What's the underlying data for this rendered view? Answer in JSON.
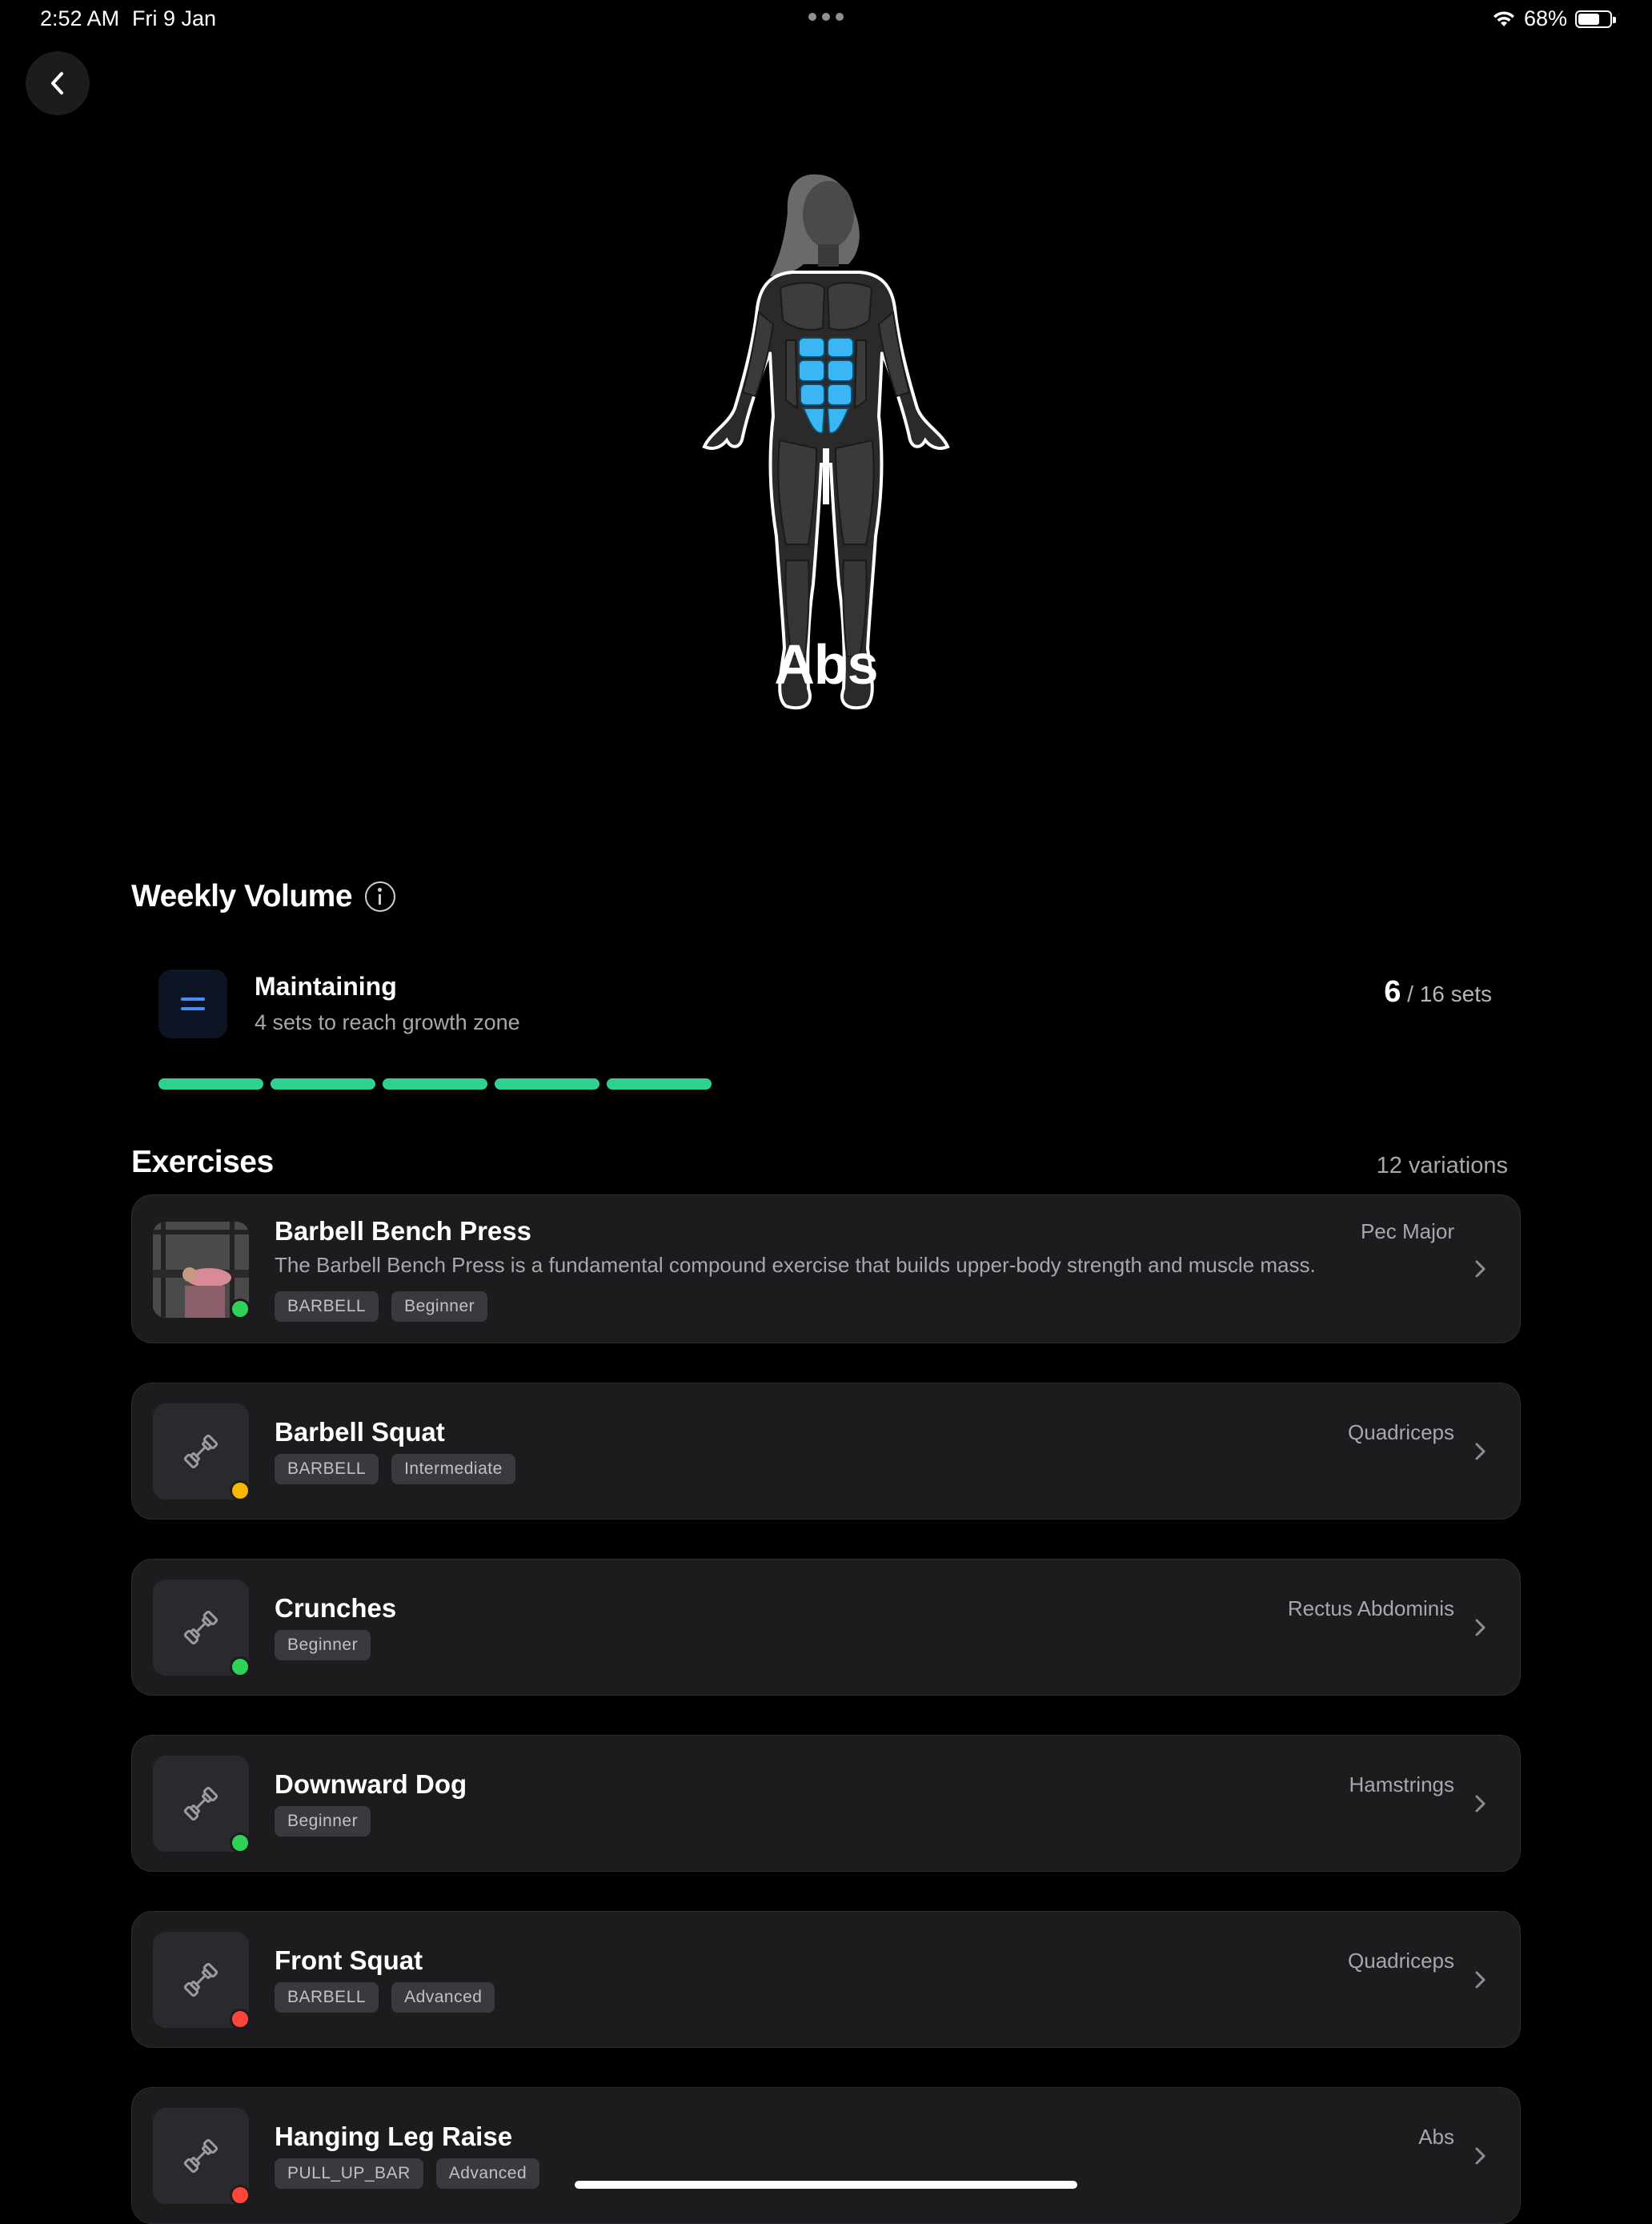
{
  "status_bar": {
    "time": "2:52 AM",
    "date": "Fri 9 Jan",
    "battery": "68%"
  },
  "muscle": {
    "name": "Abs"
  },
  "weekly_volume": {
    "title": "Weekly Volume",
    "status": "Maintaining",
    "subtitle": "4 sets to reach growth zone",
    "current": "6",
    "target_text": "/ 16 sets",
    "progress_segments_filled": 5
  },
  "exercises": {
    "title": "Exercises",
    "count_text": "12 variations",
    "items": [
      {
        "name": "Barbell Bench Press",
        "muscle": "Pec Major",
        "description": "The Barbell Bench Press is a fundamental compound exercise that builds upper-body strength and muscle mass.",
        "tags": [
          "BARBELL",
          "Beginner"
        ],
        "level_color": "#30d158",
        "has_photo": true
      },
      {
        "name": "Barbell Squat",
        "muscle": "Quadriceps",
        "tags": [
          "BARBELL",
          "Intermediate"
        ],
        "level_color": "#f5b800"
      },
      {
        "name": "Crunches",
        "muscle": "Rectus Abdominis",
        "tags": [
          "Beginner"
        ],
        "level_color": "#30d158"
      },
      {
        "name": "Downward Dog",
        "muscle": "Hamstrings",
        "tags": [
          "Beginner"
        ],
        "level_color": "#30d158"
      },
      {
        "name": "Front Squat",
        "muscle": "Quadriceps",
        "tags": [
          "BARBELL",
          "Advanced"
        ],
        "level_color": "#ff453a"
      },
      {
        "name": "Hanging Leg Raise",
        "muscle": "Abs",
        "tags": [
          "PULL_UP_BAR",
          "Advanced"
        ],
        "level_color": "#ff453a"
      }
    ]
  },
  "colors": {
    "background": "#000000",
    "card": "#1c1c1e",
    "progress": "#2ed290",
    "highlight_muscle": "#39b6f3",
    "accent_blue": "#4a8cf7"
  },
  "icons": {
    "back": "chevron-left-icon",
    "info": "info-icon",
    "volume": "equals-icon",
    "exercise_placeholder": "dumbbell-icon",
    "row_chevron": "chevron-right-icon"
  }
}
